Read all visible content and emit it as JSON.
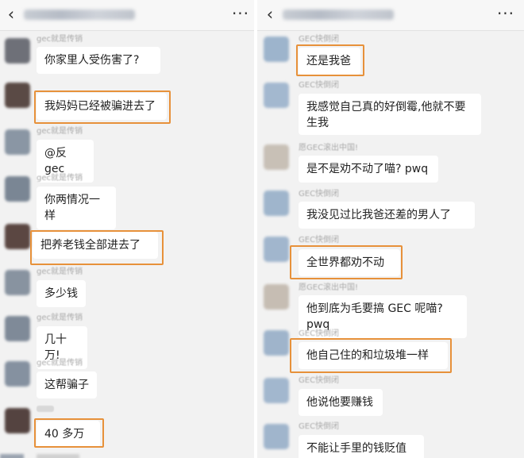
{
  "left_chat": {
    "back_icon": "‹",
    "more_icon": "···",
    "messages": [
      {
        "sender": "gec就是传销",
        "text": "你家里人受伤害了?"
      },
      {
        "sender": "",
        "text": "我妈妈已经被骗进去了"
      },
      {
        "sender": "gec就是传销",
        "text": "@反 gec"
      },
      {
        "sender": "gec就是传销",
        "text": "你两情况一样"
      },
      {
        "sender": "",
        "text": "把养老钱全部进去了"
      },
      {
        "sender": "gec就是传销",
        "text": "多少钱"
      },
      {
        "sender": "gec就是传销",
        "text": "几十万!"
      },
      {
        "sender": "gec就是传销",
        "text": "这帮骗子"
      },
      {
        "sender": "",
        "text": "40 多万"
      }
    ]
  },
  "right_chat": {
    "back_icon": "‹",
    "more_icon": "···",
    "messages": [
      {
        "sender": "GEC快倒闭",
        "text": "还是我爸"
      },
      {
        "sender": "GEC快倒闭",
        "text": "我感觉自己真的好倒霉,他就不要生我"
      },
      {
        "sender": "愿GEC滚出中国!",
        "text": "是不是劝不动了喵? pwq"
      },
      {
        "sender": "GEC快倒闭",
        "text": "我没见过比我爸还差的男人了"
      },
      {
        "sender": "GEC快倒闭",
        "text": "全世界都劝不动"
      },
      {
        "sender": "愿GEC滚出中国!",
        "text": "他到底为毛要搞 GEC 呢喵? pwq"
      },
      {
        "sender": "GEC快倒闭",
        "text": "他自己住的和垃圾堆一样"
      },
      {
        "sender": "GEC快倒闭",
        "text": "他说他要赚钱"
      },
      {
        "sender": "GEC快倒闭",
        "text": "不能让手里的钱贬值"
      }
    ]
  },
  "colors": {
    "highlight": "#e7913a",
    "background": "#f2f2f2",
    "bubble": "#ffffff"
  }
}
